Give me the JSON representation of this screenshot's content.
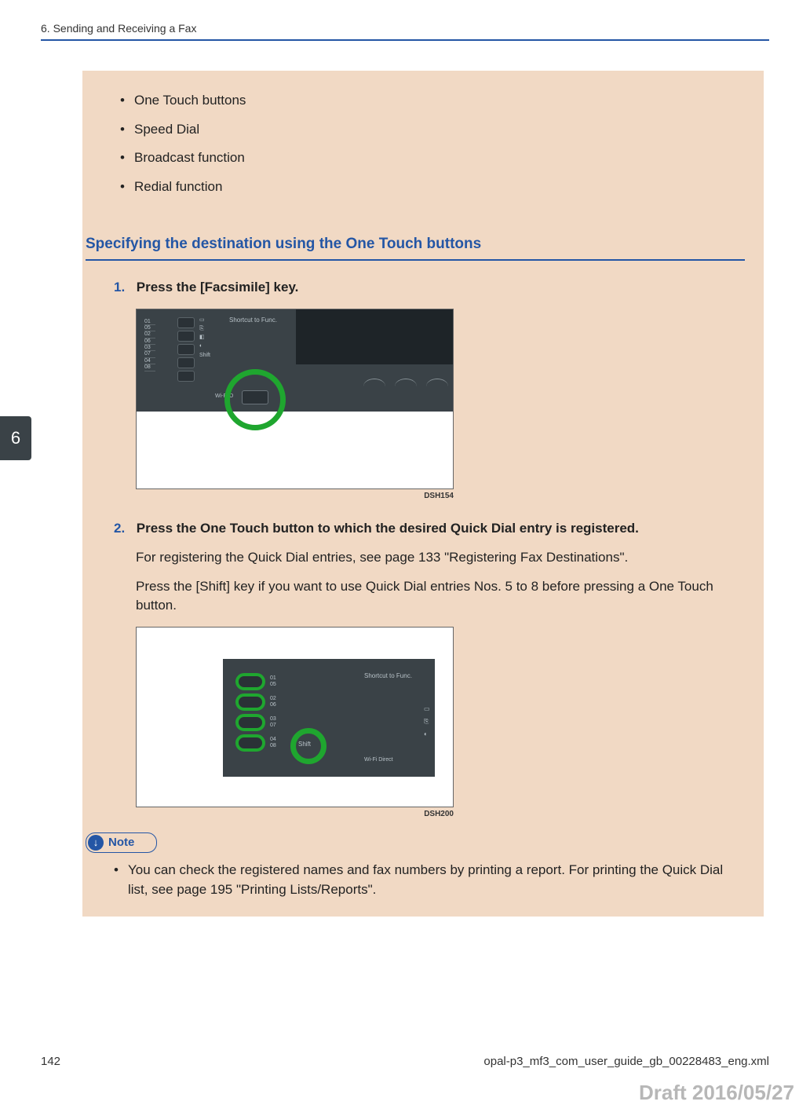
{
  "header": {
    "breadcrumb": "6. Sending and Receiving a Fax"
  },
  "chapterTab": "6",
  "topList": [
    "One Touch buttons",
    "Speed Dial",
    "Broadcast function",
    "Redial function"
  ],
  "sectionHeading": "Specifying the destination using the One Touch buttons",
  "steps": {
    "s1": {
      "num": "1.",
      "title": "Press the [Facsimile] key.",
      "panelNums": [
        "01",
        "05",
        "02",
        "06",
        "03",
        "07",
        "04",
        "08"
      ],
      "shortcutLabel": "Shortcut to Func.",
      "shiftLabel": "Shift",
      "wifiLabel": "Wi-Fi D",
      "caption": "DSH154"
    },
    "s2": {
      "num": "2.",
      "title": "Press the One Touch button to which the desired Quick Dial entry is registered.",
      "body1": "For registering the Quick Dial entries, see page 133 \"Registering Fax Destinations\".",
      "body2": "Press the [Shift] key if you want to use Quick Dial entries Nos. 5 to 8 before pressing a One Touch button.",
      "rows": [
        {
          "a": "01",
          "b": "05"
        },
        {
          "a": "02",
          "b": "06"
        },
        {
          "a": "03",
          "b": "07"
        },
        {
          "a": "04",
          "b": "08"
        }
      ],
      "shortcutLabel": "Shortcut to Func.",
      "shiftLabel": "Shift",
      "wifiLabel": "Wi-Fi Direct",
      "caption": "DSH200"
    }
  },
  "note": {
    "label": "Note",
    "text": "You can check the registered names and fax numbers by printing a report. For printing the Quick Dial list, see page 195 \"Printing Lists/Reports\"."
  },
  "footer": {
    "pageNum": "142",
    "filePath": "opal-p3_mf3_com_user_guide_gb_00228483_eng.xml"
  },
  "draft": "Draft 2016/05/27"
}
